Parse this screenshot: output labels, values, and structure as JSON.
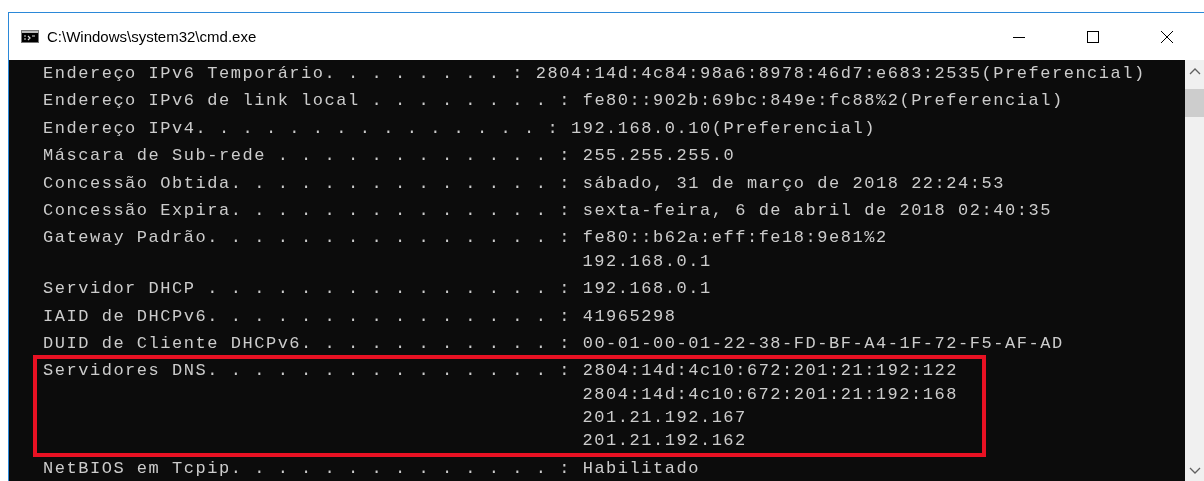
{
  "window": {
    "title": "C:\\Windows\\system32\\cmd.exe"
  },
  "console": {
    "entries": [
      {
        "label": "Endereço IPv6 Temporário. . . . . . . . :",
        "values": [
          "2804:14d:4c84:98a6:8978:46d7:e683:2535(Preferencial)"
        ],
        "highlighted": false
      },
      {
        "label": "Endereço IPv6 de link local . . . . . . . . :",
        "values": [
          "fe80::902b:69bc:849e:fc88%2(Preferencial)"
        ],
        "highlighted": false
      },
      {
        "label": "Endereço IPv4. . . . . . . . . . . . . . . :",
        "values": [
          "192.168.0.10(Preferencial)"
        ],
        "highlighted": false
      },
      {
        "label": "Máscara de Sub-rede . . . . . . . . . . . . :",
        "values": [
          "255.255.255.0"
        ],
        "highlighted": false
      },
      {
        "label": "Concessão Obtida. . . . . . . . . . . . . . :",
        "values": [
          "sábado, 31 de março de 2018 22:24:53"
        ],
        "highlighted": false
      },
      {
        "label": "Concessão Expira. . . . . . . . . . . . . . :",
        "values": [
          "sexta-feira, 6 de abril de 2018 02:40:35"
        ],
        "highlighted": false
      },
      {
        "label": "Gateway Padrão. . . . . . . . . . . . . . . :",
        "values": [
          "fe80::b62a:eff:fe18:9e81%2",
          "192.168.0.1"
        ],
        "highlighted": false
      },
      {
        "label": "Servidor DHCP . . . . . . . . . . . . . . . :",
        "values": [
          "192.168.0.1"
        ],
        "highlighted": false
      },
      {
        "label": "IAID de DHCPv6. . . . . . . . . . . . . . . :",
        "values": [
          "41965298"
        ],
        "highlighted": false
      },
      {
        "label": "DUID de Cliente DHCPv6. . . . . . . . . . . :",
        "values": [
          "00-01-00-01-22-38-FD-BF-A4-1F-72-F5-AF-AD"
        ],
        "highlighted": false
      },
      {
        "label": "Servidores DNS. . . . . . . . . . . . . . . :",
        "values": [
          "2804:14d:4c10:672:201:21:192:122",
          "2804:14d:4c10:672:201:21:192:168",
          "201.21.192.167",
          "201.21.192.162"
        ],
        "highlighted": true
      },
      {
        "label": "NetBIOS em Tcpip. . . . . . . . . . . . . . :",
        "values": [
          "Habilitado"
        ],
        "highlighted": false
      }
    ]
  }
}
